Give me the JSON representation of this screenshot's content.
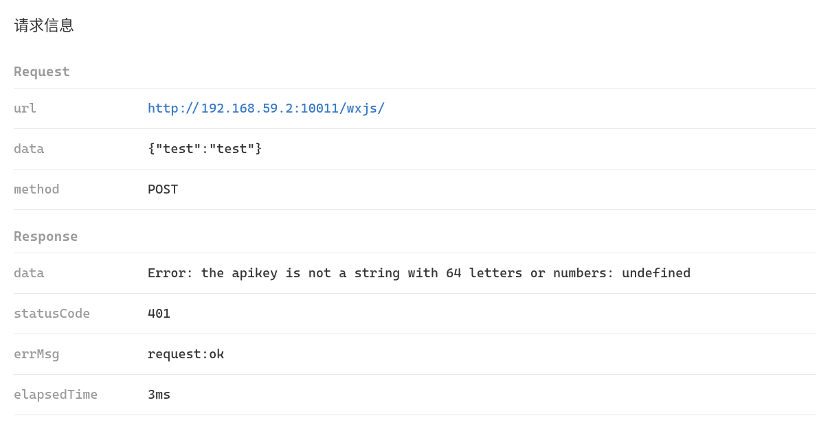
{
  "panel": {
    "title": "请求信息"
  },
  "request": {
    "header": "Request",
    "fields": {
      "url": {
        "key": "url",
        "value": "http://192.168.59.2:10011/wxjs/"
      },
      "data": {
        "key": "data",
        "value": "{\"test\":\"test\"}"
      },
      "method": {
        "key": "method",
        "value": "POST"
      }
    }
  },
  "response": {
    "header": "Response",
    "fields": {
      "data": {
        "key": "data",
        "value": "Error: the apikey is not a string with 64 letters or numbers: undefined"
      },
      "statusCode": {
        "key": "statusCode",
        "value": "401"
      },
      "errMsg": {
        "key": "errMsg",
        "value": "request:ok"
      },
      "elapsedTime": {
        "key": "elapsedTime",
        "value": "3ms"
      }
    }
  }
}
